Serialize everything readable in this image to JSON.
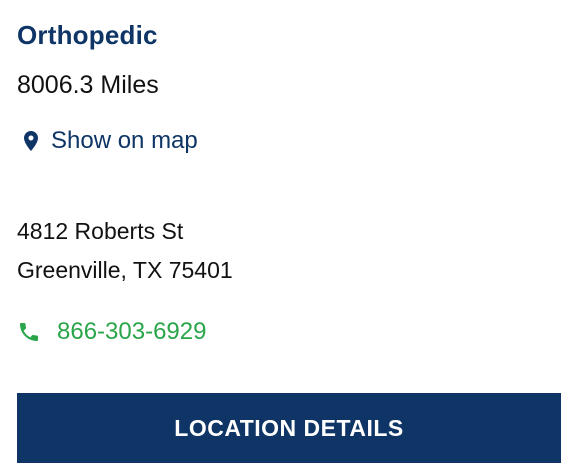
{
  "location": {
    "title": "Orthopedic",
    "distance": "8006.3 Miles",
    "map_link_label": "Show on map",
    "address_line1": "4812 Roberts St",
    "address_line2": "Greenville, TX 75401",
    "phone": "866-303-6929",
    "details_button_label": "LOCATION DETAILS"
  },
  "icons": {
    "map_link": "map-pin-icon",
    "phone": "phone-icon"
  },
  "colors": {
    "brand_navy": "#0e3566",
    "phone_green": "#2aa54a",
    "text": "#111111",
    "background": "#ffffff"
  }
}
